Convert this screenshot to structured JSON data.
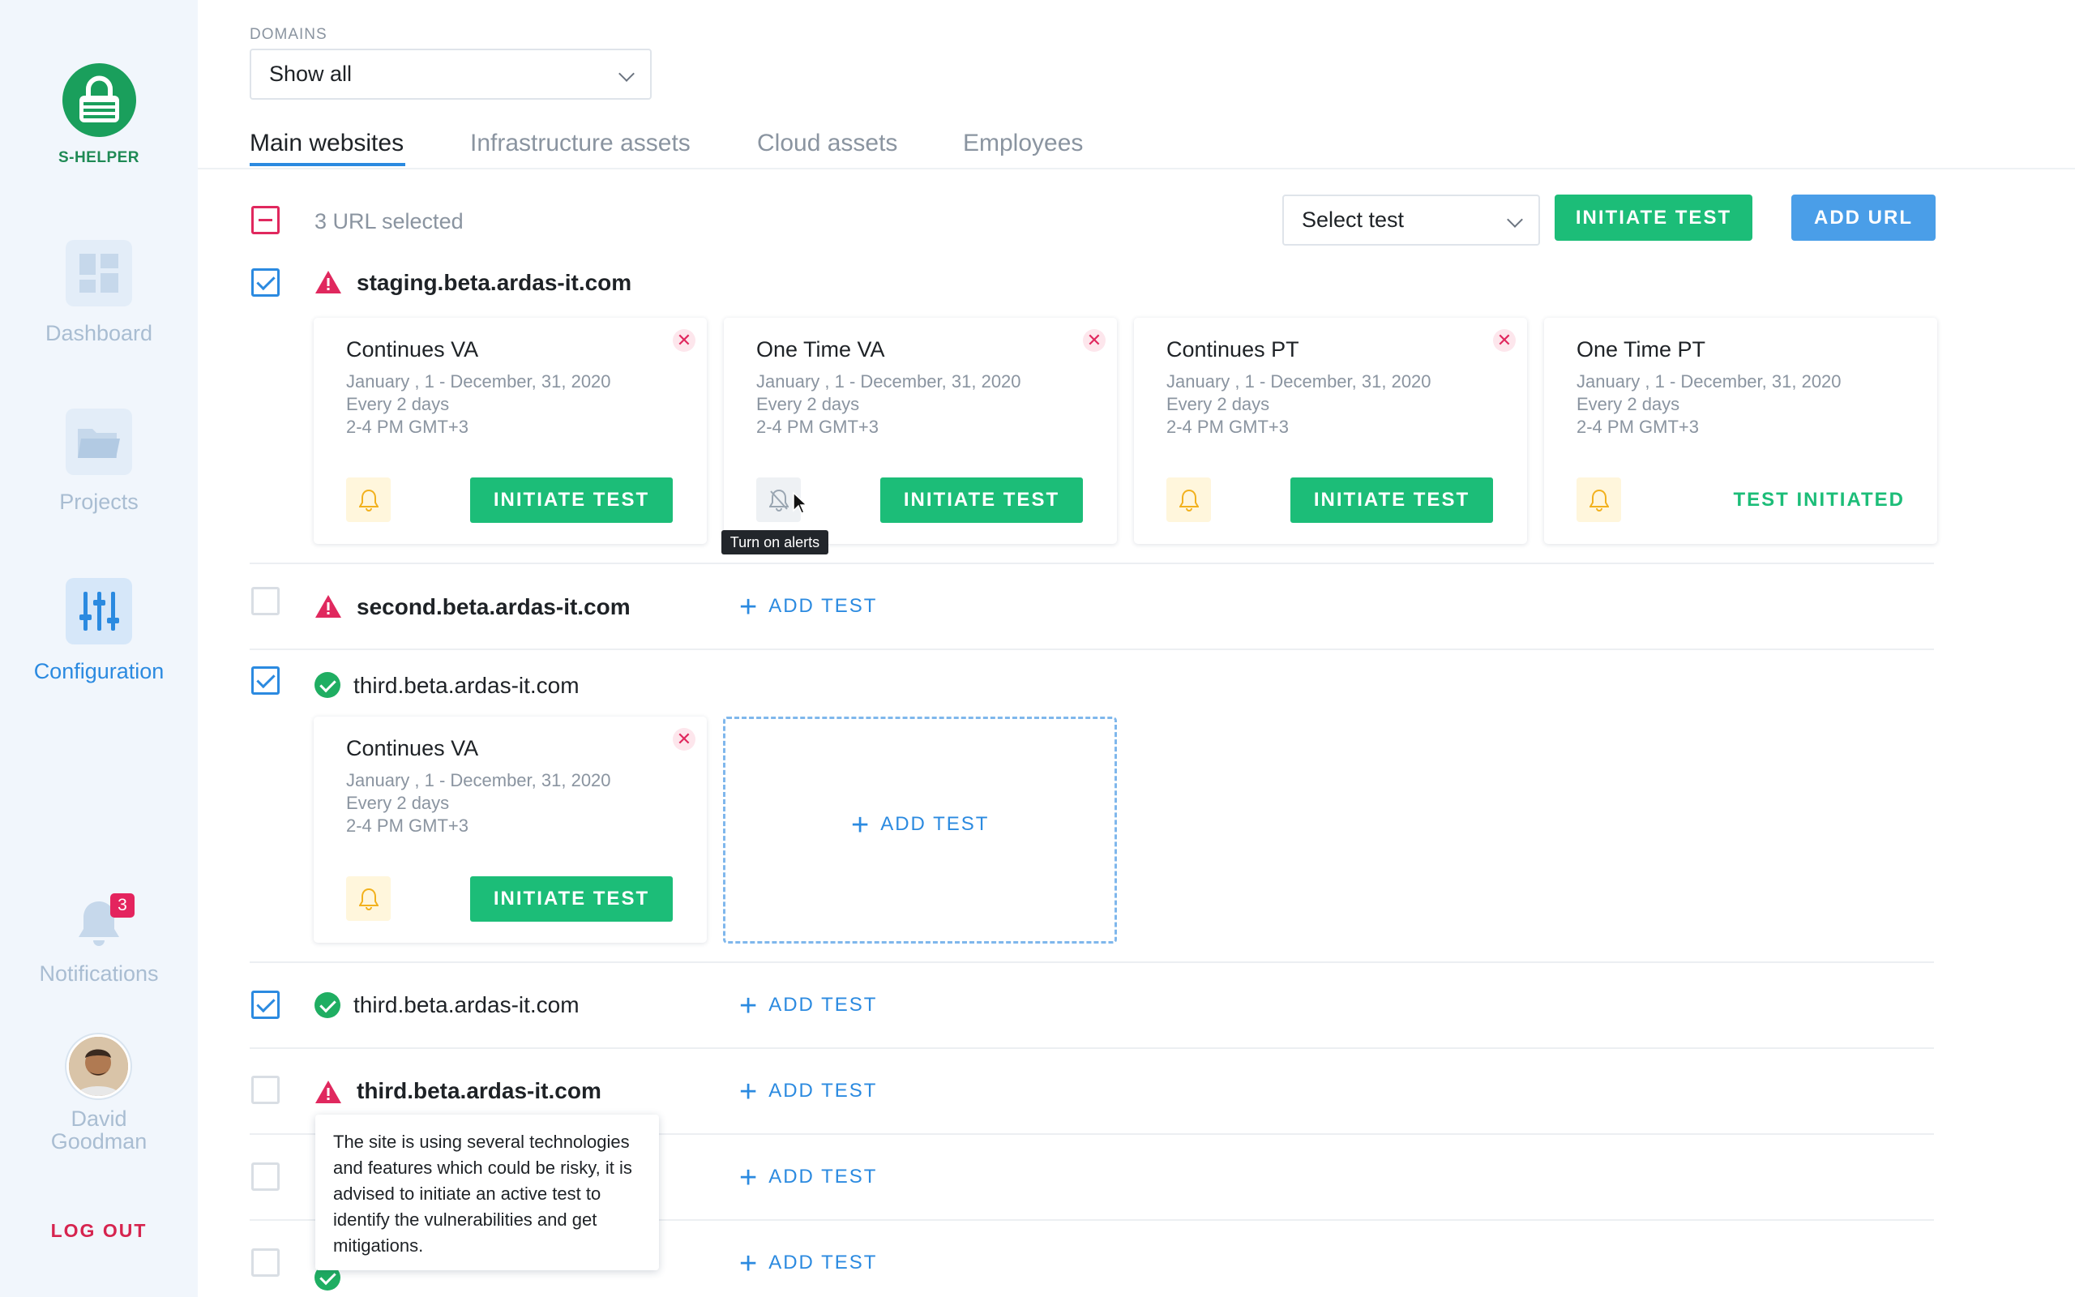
{
  "sidebar": {
    "logo_text": "S-HELPER",
    "nav": [
      {
        "label": "Dashboard",
        "icon": "dashboard-icon",
        "active": false
      },
      {
        "label": "Projects",
        "icon": "folder-icon",
        "active": false
      },
      {
        "label": "Configuration",
        "icon": "sliders-icon",
        "active": true
      }
    ],
    "notifications": {
      "label": "Notifications",
      "count": "3"
    },
    "user": {
      "first_name": "David",
      "last_name": "Goodman"
    },
    "logout": "LOG OUT"
  },
  "header": {
    "domains_label": "DOMAINS",
    "domains_value": "Show all",
    "tabs": [
      "Main websites",
      "Infrastructure assets",
      "Cloud assets",
      "Employees"
    ],
    "active_tab": "Main websites"
  },
  "toolbar": {
    "selected_text": "3 URL selected",
    "select_test_value": "Select test",
    "initiate_label": "INITIATE TEST",
    "add_url_label": "ADD URL"
  },
  "rows": [
    {
      "host": "staging.beta.ardas-it.com",
      "status": "warning",
      "checked": true
    },
    {
      "host": "second.beta.ardas-it.com",
      "status": "warning",
      "checked": false,
      "add_test": "ADD TEST"
    },
    {
      "host": "third.beta.ardas-it.com",
      "status": "ok",
      "checked": true
    },
    {
      "host": "third.beta.ardas-it.com",
      "status": "ok",
      "checked": true,
      "add_test": "ADD TEST"
    },
    {
      "host": "third.beta.ardas-it.com",
      "status": "warning",
      "checked": false,
      "add_test": "ADD TEST"
    },
    {
      "host": "",
      "checked": false,
      "add_test": "ADD TEST"
    },
    {
      "host": "",
      "checked": false,
      "add_test": "ADD TEST"
    }
  ],
  "cards_row1": [
    {
      "title": "Continues VA",
      "dates": "January , 1 - December, 31, 2020",
      "freq": "Every 2 days",
      "time": "2-4 PM GMT+3",
      "action": "INITIATE TEST"
    },
    {
      "title": "One Time VA",
      "dates": "January , 1 - December, 31, 2020",
      "freq": "Every 2 days",
      "time": "2-4 PM GMT+3",
      "action": "INITIATE TEST"
    },
    {
      "title": "Continues  PT",
      "dates": "January , 1 - December, 31, 2020",
      "freq": "Every 2 days",
      "time": "2-4 PM GMT+3",
      "action": "INITIATE TEST"
    },
    {
      "title": "One Time PT",
      "dates": "January , 1 - December, 31, 2020",
      "freq": "Every 2 days",
      "time": "2-4 PM GMT+3",
      "status": "TEST INITIATED"
    }
  ],
  "cards_row3": [
    {
      "title": "Continues VA",
      "dates": "January , 1 - December, 31, 2020",
      "freq": "Every 2 days",
      "time": "2-4 PM GMT+3",
      "action": "INITIATE TEST"
    }
  ],
  "add_test_label": "ADD TEST",
  "alert_tooltip": "Turn on alerts",
  "risk_tooltip": "The site is using several technologies and features which could be risky, it is advised to initiate an active test to identify the vulnerabilities and get mitigations.",
  "colors": {
    "accent": "#2b8ae0",
    "green": "#1cbd78",
    "danger": "#e0285e"
  }
}
